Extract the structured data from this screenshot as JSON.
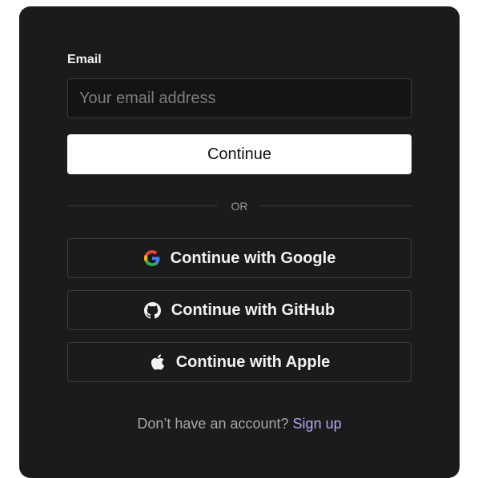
{
  "form": {
    "email_label": "Email",
    "email_value": "",
    "email_placeholder": "Your email address",
    "continue_label": "Continue",
    "divider_text": "OR"
  },
  "social": {
    "google": {
      "label": "Continue with Google",
      "icon": "google-icon"
    },
    "github": {
      "label": "Continue with GitHub",
      "icon": "github-icon"
    },
    "apple": {
      "label": "Continue with Apple",
      "icon": "apple-icon"
    }
  },
  "signup": {
    "prompt": "Don’t have an account?",
    "link_label": "Sign up"
  },
  "colors": {
    "card_background": "#1b1b1b",
    "primary_button": "#ffffff",
    "link_accent": "#b9a3f5",
    "google_blue": "#4285F4",
    "google_red": "#EA4335",
    "google_yellow": "#FBBC05",
    "google_green": "#34A853"
  }
}
